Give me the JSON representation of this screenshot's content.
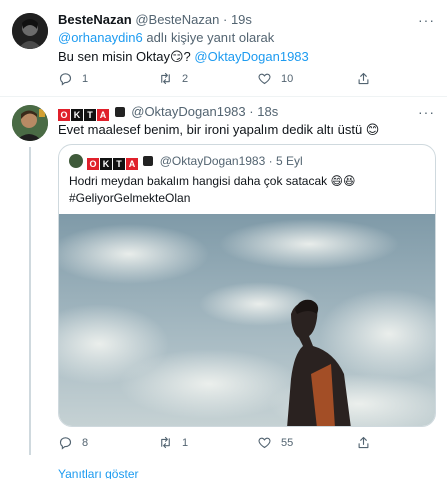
{
  "tweet1": {
    "name": "BesteNazan",
    "handle": "@BesteNazan",
    "dot": "·",
    "time": "19s",
    "reply_handle": "@orhanaydin6",
    "reply_suffix": " adlı kişiye yanıt olarak",
    "text_start": "Bu sen misin Oktay😏? ",
    "mention": "@OktayDogan1983",
    "actions": {
      "reply_count": "1",
      "retweet_count": "2",
      "like_count": "10"
    }
  },
  "tweet2": {
    "name_letters": [
      "O",
      "K",
      "T",
      "A"
    ],
    "handle": "@OktayDogan1983",
    "dot": "·",
    "time": "18s",
    "text": "Evet maalesef benim, bir ironi yapalım dedik altı üstü 😊",
    "quote": {
      "name_letters": [
        "O",
        "K",
        "T",
        "A"
      ],
      "handle": "@OktayDogan1983",
      "dot": "·",
      "time": "5 Eyl",
      "text": "Hodri meydan bakalım hangisi daha çok satacak 😄😆",
      "hashtag": "#GeliyorGelmekteOlan"
    },
    "actions": {
      "reply_count": "8",
      "retweet_count": "1",
      "like_count": "55"
    },
    "show_replies": "Yanıtları göster"
  },
  "more_icon": "···",
  "colors": {
    "link": "#1d9bf0",
    "muted": "#536471",
    "border": "#cfd9de",
    "logo_red": "#e0202b"
  }
}
